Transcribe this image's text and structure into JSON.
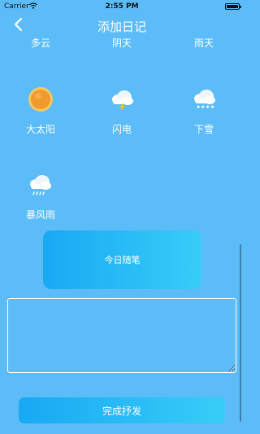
{
  "status_bar": {
    "carrier": "Carrier",
    "time": "2:55 PM"
  },
  "nav": {
    "title": "添加日记",
    "back_icon": "chevron-left-icon"
  },
  "weather_top_row": [
    "多云",
    "阴天",
    "雨天"
  ],
  "weather_options": [
    {
      "label": "大太阳",
      "icon": "sun-icon"
    },
    {
      "label": "闪电",
      "icon": "lightning-icon"
    },
    {
      "label": "下雪",
      "icon": "snow-icon"
    },
    {
      "label": "暴风雨",
      "icon": "storm-icon"
    }
  ],
  "diary_button": {
    "label": "今日随笔"
  },
  "diary_text": {
    "value": ""
  },
  "submit_button": {
    "label": "完成抒发"
  },
  "colors": {
    "background": "#5bbcf7",
    "button_start": "#19a8f3",
    "button_end": "#37cdf8"
  }
}
